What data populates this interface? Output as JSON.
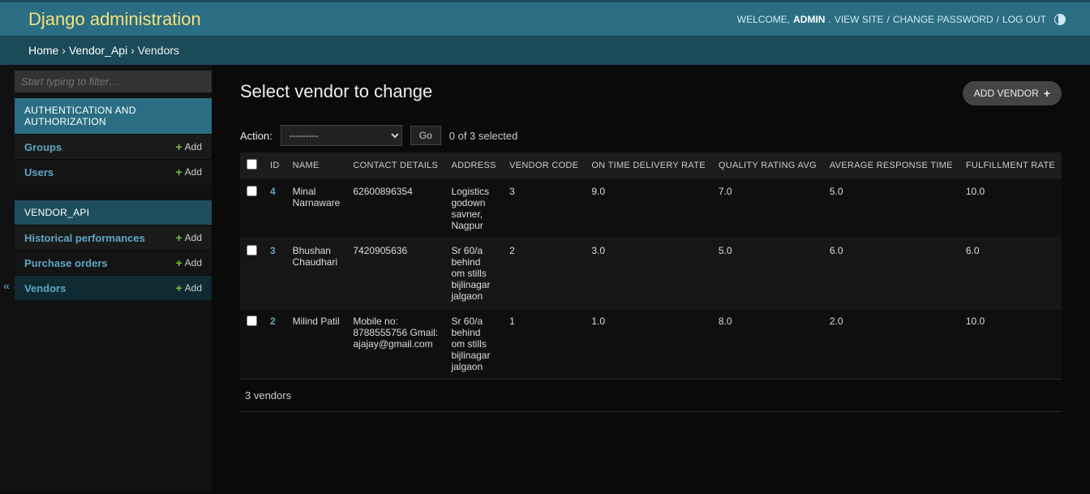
{
  "header": {
    "branding": "Django administration",
    "welcome": "WELCOME,",
    "username": "ADMIN",
    "view_site": "VIEW SITE",
    "change_password": "CHANGE PASSWORD",
    "log_out": "LOG OUT"
  },
  "breadcrumbs": {
    "home": "Home",
    "app": "Vendor_Api",
    "model": "Vendors"
  },
  "sidebar": {
    "filter_placeholder": "Start typing to filter…",
    "add_label": "Add",
    "apps": [
      {
        "label": "AUTHENTICATION AND AUTHORIZATION",
        "models": [
          {
            "label": "Groups"
          },
          {
            "label": "Users"
          }
        ]
      },
      {
        "label": "VENDOR_API",
        "models": [
          {
            "label": "Historical performances"
          },
          {
            "label": "Purchase orders"
          },
          {
            "label": "Vendors",
            "active": true
          }
        ]
      }
    ]
  },
  "content": {
    "title": "Select vendor to change",
    "add_button": "ADD VENDOR",
    "action_label": "Action:",
    "action_placeholder": "---------",
    "go_label": "Go",
    "selection_counter": "0 of 3 selected",
    "columns": [
      "",
      "ID",
      "NAME",
      "CONTACT DETAILS",
      "ADDRESS",
      "VENDOR CODE",
      "ON TIME DELIVERY RATE",
      "QUALITY RATING AVG",
      "AVERAGE RESPONSE TIME",
      "FULFILLMENT RATE"
    ],
    "rows": [
      {
        "id": "4",
        "name": "Minal Narnaware",
        "contact": "62600896354",
        "address": "Logistics godown savner, Nagpur",
        "vendor_code": "3",
        "on_time": "9.0",
        "quality": "7.0",
        "response": "5.0",
        "fulfillment": "10.0"
      },
      {
        "id": "3",
        "name": "Bhushan Chaudhari",
        "contact": "7420905636",
        "address": "Sr 60/a behind om stills bijlinagar jalgaon",
        "vendor_code": "2",
        "on_time": "3.0",
        "quality": "5.0",
        "response": "6.0",
        "fulfillment": "6.0"
      },
      {
        "id": "2",
        "name": "Milind Patil",
        "contact": "Mobile no: 8788555756 Gmail: ajajay@gmail.com",
        "address": "Sr 60/a behind om stills bijlinagar jalgaon",
        "vendor_code": "1",
        "on_time": "1.0",
        "quality": "8.0",
        "response": "2.0",
        "fulfillment": "10.0"
      }
    ],
    "paginator": "3 vendors"
  }
}
